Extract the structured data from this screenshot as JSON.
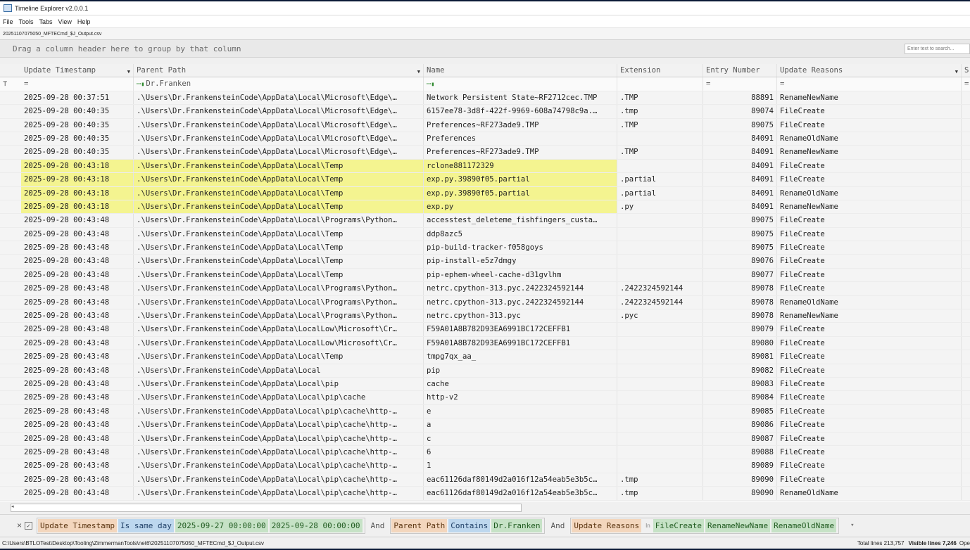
{
  "window": {
    "title": "Timeline Explorer v2.0.0.1"
  },
  "menu": [
    "File",
    "Tools",
    "Tabs",
    "View",
    "Help"
  ],
  "tab": {
    "name": "20251107075050_MFTECmd_$J_Output.csv"
  },
  "group_prompt": "Drag a column header here to group by that column",
  "search": {
    "placeholder": "Enter text to search..."
  },
  "columns": [
    "Update Timestamp",
    "Parent Path",
    "Name",
    "Extension",
    "Entry Number",
    "Update Reasons",
    "S"
  ],
  "filter_row": {
    "timestamp": "=",
    "parent_path": "Dr.Franken",
    "entry_number": "=",
    "update_reasons": "=",
    "last": "="
  },
  "rows": [
    {
      "ts": "2025-09-28 00:37:51",
      "path": ".\\Users\\Dr.FrankensteinCode\\AppData\\Local\\Microsoft\\Edge\\…",
      "name": "Network Persistent State~RF2712cec.TMP",
      "ext": ".TMP",
      "entry": "88891",
      "reason": "RenameNewName",
      "hl": false
    },
    {
      "ts": "2025-09-28 00:40:35",
      "path": ".\\Users\\Dr.FrankensteinCode\\AppData\\Local\\Microsoft\\Edge\\…",
      "name": "6157ee78-3d8f-422f-9969-608a74798c9a.…",
      "ext": ".tmp",
      "entry": "89074",
      "reason": "FileCreate",
      "hl": false
    },
    {
      "ts": "2025-09-28 00:40:35",
      "path": ".\\Users\\Dr.FrankensteinCode\\AppData\\Local\\Microsoft\\Edge\\…",
      "name": "Preferences~RF273ade9.TMP",
      "ext": ".TMP",
      "entry": "89075",
      "reason": "FileCreate",
      "hl": false
    },
    {
      "ts": "2025-09-28 00:40:35",
      "path": ".\\Users\\Dr.FrankensteinCode\\AppData\\Local\\Microsoft\\Edge\\…",
      "name": "Preferences",
      "ext": "",
      "entry": "84091",
      "reason": "RenameOldName",
      "hl": false
    },
    {
      "ts": "2025-09-28 00:40:35",
      "path": ".\\Users\\Dr.FrankensteinCode\\AppData\\Local\\Microsoft\\Edge\\…",
      "name": "Preferences~RF273ade9.TMP",
      "ext": ".TMP",
      "entry": "84091",
      "reason": "RenameNewName",
      "hl": false
    },
    {
      "ts": "2025-09-28 00:43:18",
      "path": ".\\Users\\Dr.FrankensteinCode\\AppData\\Local\\Temp",
      "name": "rclone881172329",
      "ext": "",
      "entry": "84091",
      "reason": "FileCreate",
      "hl": true
    },
    {
      "ts": "2025-09-28 00:43:18",
      "path": ".\\Users\\Dr.FrankensteinCode\\AppData\\Local\\Temp",
      "name": "exp.py.39890f05.partial",
      "ext": ".partial",
      "entry": "84091",
      "reason": "FileCreate",
      "hl": true
    },
    {
      "ts": "2025-09-28 00:43:18",
      "path": ".\\Users\\Dr.FrankensteinCode\\AppData\\Local\\Temp",
      "name": "exp.py.39890f05.partial",
      "ext": ".partial",
      "entry": "84091",
      "reason": "RenameOldName",
      "hl": true
    },
    {
      "ts": "2025-09-28 00:43:18",
      "path": ".\\Users\\Dr.FrankensteinCode\\AppData\\Local\\Temp",
      "name": "exp.py",
      "ext": ".py",
      "entry": "84091",
      "reason": "RenameNewName",
      "hl": true
    },
    {
      "ts": "2025-09-28 00:43:48",
      "path": ".\\Users\\Dr.FrankensteinCode\\AppData\\Local\\Programs\\Python…",
      "name": "accesstest_deleteme_fishfingers_custa…",
      "ext": "",
      "entry": "89075",
      "reason": "FileCreate",
      "hl": false
    },
    {
      "ts": "2025-09-28 00:43:48",
      "path": ".\\Users\\Dr.FrankensteinCode\\AppData\\Local\\Temp",
      "name": "ddp8azc5",
      "ext": "",
      "entry": "89075",
      "reason": "FileCreate",
      "hl": false
    },
    {
      "ts": "2025-09-28 00:43:48",
      "path": ".\\Users\\Dr.FrankensteinCode\\AppData\\Local\\Temp",
      "name": "pip-build-tracker-f058goys",
      "ext": "",
      "entry": "89075",
      "reason": "FileCreate",
      "hl": false
    },
    {
      "ts": "2025-09-28 00:43:48",
      "path": ".\\Users\\Dr.FrankensteinCode\\AppData\\Local\\Temp",
      "name": "pip-install-e5z7dmgy",
      "ext": "",
      "entry": "89076",
      "reason": "FileCreate",
      "hl": false
    },
    {
      "ts": "2025-09-28 00:43:48",
      "path": ".\\Users\\Dr.FrankensteinCode\\AppData\\Local\\Temp",
      "name": "pip-ephem-wheel-cache-d31gvlhm",
      "ext": "",
      "entry": "89077",
      "reason": "FileCreate",
      "hl": false
    },
    {
      "ts": "2025-09-28 00:43:48",
      "path": ".\\Users\\Dr.FrankensteinCode\\AppData\\Local\\Programs\\Python…",
      "name": "netrc.cpython-313.pyc.2422324592144",
      "ext": ".2422324592144",
      "entry": "89078",
      "reason": "FileCreate",
      "hl": false
    },
    {
      "ts": "2025-09-28 00:43:48",
      "path": ".\\Users\\Dr.FrankensteinCode\\AppData\\Local\\Programs\\Python…",
      "name": "netrc.cpython-313.pyc.2422324592144",
      "ext": ".2422324592144",
      "entry": "89078",
      "reason": "RenameOldName",
      "hl": false
    },
    {
      "ts": "2025-09-28 00:43:48",
      "path": ".\\Users\\Dr.FrankensteinCode\\AppData\\Local\\Programs\\Python…",
      "name": "netrc.cpython-313.pyc",
      "ext": ".pyc",
      "entry": "89078",
      "reason": "RenameNewName",
      "hl": false
    },
    {
      "ts": "2025-09-28 00:43:48",
      "path": ".\\Users\\Dr.FrankensteinCode\\AppData\\LocalLow\\Microsoft\\Cr…",
      "name": "F59A01A8B782D93EA6991BC172CEFFB1",
      "ext": "",
      "entry": "89079",
      "reason": "FileCreate",
      "hl": false
    },
    {
      "ts": "2025-09-28 00:43:48",
      "path": ".\\Users\\Dr.FrankensteinCode\\AppData\\LocalLow\\Microsoft\\Cr…",
      "name": "F59A01A8B782D93EA6991BC172CEFFB1",
      "ext": "",
      "entry": "89080",
      "reason": "FileCreate",
      "hl": false
    },
    {
      "ts": "2025-09-28 00:43:48",
      "path": ".\\Users\\Dr.FrankensteinCode\\AppData\\Local\\Temp",
      "name": "tmpg7qx_aa_",
      "ext": "",
      "entry": "89081",
      "reason": "FileCreate",
      "hl": false
    },
    {
      "ts": "2025-09-28 00:43:48",
      "path": ".\\Users\\Dr.FrankensteinCode\\AppData\\Local",
      "name": "pip",
      "ext": "",
      "entry": "89082",
      "reason": "FileCreate",
      "hl": false
    },
    {
      "ts": "2025-09-28 00:43:48",
      "path": ".\\Users\\Dr.FrankensteinCode\\AppData\\Local\\pip",
      "name": "cache",
      "ext": "",
      "entry": "89083",
      "reason": "FileCreate",
      "hl": false
    },
    {
      "ts": "2025-09-28 00:43:48",
      "path": ".\\Users\\Dr.FrankensteinCode\\AppData\\Local\\pip\\cache",
      "name": "http-v2",
      "ext": "",
      "entry": "89084",
      "reason": "FileCreate",
      "hl": false
    },
    {
      "ts": "2025-09-28 00:43:48",
      "path": ".\\Users\\Dr.FrankensteinCode\\AppData\\Local\\pip\\cache\\http-…",
      "name": "e",
      "ext": "",
      "entry": "89085",
      "reason": "FileCreate",
      "hl": false
    },
    {
      "ts": "2025-09-28 00:43:48",
      "path": ".\\Users\\Dr.FrankensteinCode\\AppData\\Local\\pip\\cache\\http-…",
      "name": "a",
      "ext": "",
      "entry": "89086",
      "reason": "FileCreate",
      "hl": false
    },
    {
      "ts": "2025-09-28 00:43:48",
      "path": ".\\Users\\Dr.FrankensteinCode\\AppData\\Local\\pip\\cache\\http-…",
      "name": "c",
      "ext": "",
      "entry": "89087",
      "reason": "FileCreate",
      "hl": false
    },
    {
      "ts": "2025-09-28 00:43:48",
      "path": ".\\Users\\Dr.FrankensteinCode\\AppData\\Local\\pip\\cache\\http-…",
      "name": "6",
      "ext": "",
      "entry": "89088",
      "reason": "FileCreate",
      "hl": false
    },
    {
      "ts": "2025-09-28 00:43:48",
      "path": ".\\Users\\Dr.FrankensteinCode\\AppData\\Local\\pip\\cache\\http-…",
      "name": "1",
      "ext": "",
      "entry": "89089",
      "reason": "FileCreate",
      "hl": false
    },
    {
      "ts": "2025-09-28 00:43:48",
      "path": ".\\Users\\Dr.FrankensteinCode\\AppData\\Local\\pip\\cache\\http-…",
      "name": "eac61126daf80149d2a016f12a54eab5e3b5c…",
      "ext": ".tmp",
      "entry": "89090",
      "reason": "FileCreate",
      "hl": false
    },
    {
      "ts": "2025-09-28 00:43:48",
      "path": ".\\Users\\Dr.FrankensteinCode\\AppData\\Local\\pip\\cache\\http-…",
      "name": "eac61126daf80149d2a016f12a54eab5e3b5c…",
      "ext": ".tmp",
      "entry": "89090",
      "reason": "RenameOldName",
      "hl": false
    }
  ],
  "filter_bar": {
    "close": "×",
    "f1_field": "Update Timestamp",
    "f1_op": "Is same day",
    "f1_v1": "2025-09-27 00:00:00",
    "f1_v2": "2025-09-28 00:00:00",
    "and1": "And",
    "f2_field": "Parent Path",
    "f2_op": "Contains",
    "f2_val": "Dr.Franken",
    "and2": "And",
    "f3_field": "Update Reasons",
    "f3_op": "In",
    "f3_v1": "FileCreate",
    "f3_v2": "RenameNewName",
    "f3_v3": "RenameOldName"
  },
  "status": {
    "path": "C:\\Users\\BTLOTest\\Desktop\\Tooling\\ZimmermanTools\\net6\\20251107075050_MFTECmd_$J_Output.csv",
    "total": "Total lines 213,757",
    "visible": "Visible lines 7,246",
    "extra": "Ope"
  },
  "colors": {
    "highlight": "#f4f490",
    "background": "#0b1a36"
  }
}
